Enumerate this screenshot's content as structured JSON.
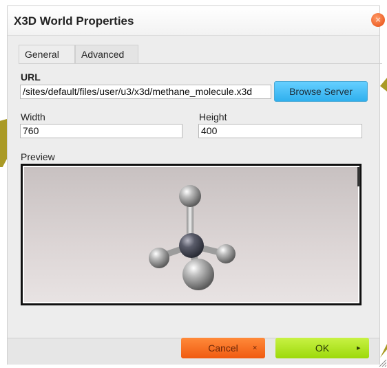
{
  "dialog": {
    "title": "X3D World Properties",
    "close_symbol": "×"
  },
  "tabs": [
    {
      "label": "General",
      "selected": true
    },
    {
      "label": "Advanced",
      "selected": false
    }
  ],
  "form": {
    "url_label": "URL",
    "url_value": "/sites/default/files/user/u3/x3d/methane_molecule.x3d",
    "browse_label": "Browse Server",
    "width_label": "Width",
    "width_value": "760",
    "height_label": "Height",
    "height_value": "400",
    "preview_label": "Preview"
  },
  "footer": {
    "cancel_label": "Cancel",
    "cancel_glyph": "×",
    "ok_label": "OK",
    "ok_glyph": "▸"
  },
  "colors": {
    "browse_button": "#2fb0ee",
    "cancel_button": "#f05a10",
    "ok_button": "#9dd90a",
    "close_button": "#e64a10",
    "background_accent": "#aa9a26"
  },
  "icons": {
    "close": "close-icon",
    "cancel": "close-icon",
    "ok": "caret-right-icon",
    "resize": "resize-grip-icon"
  }
}
